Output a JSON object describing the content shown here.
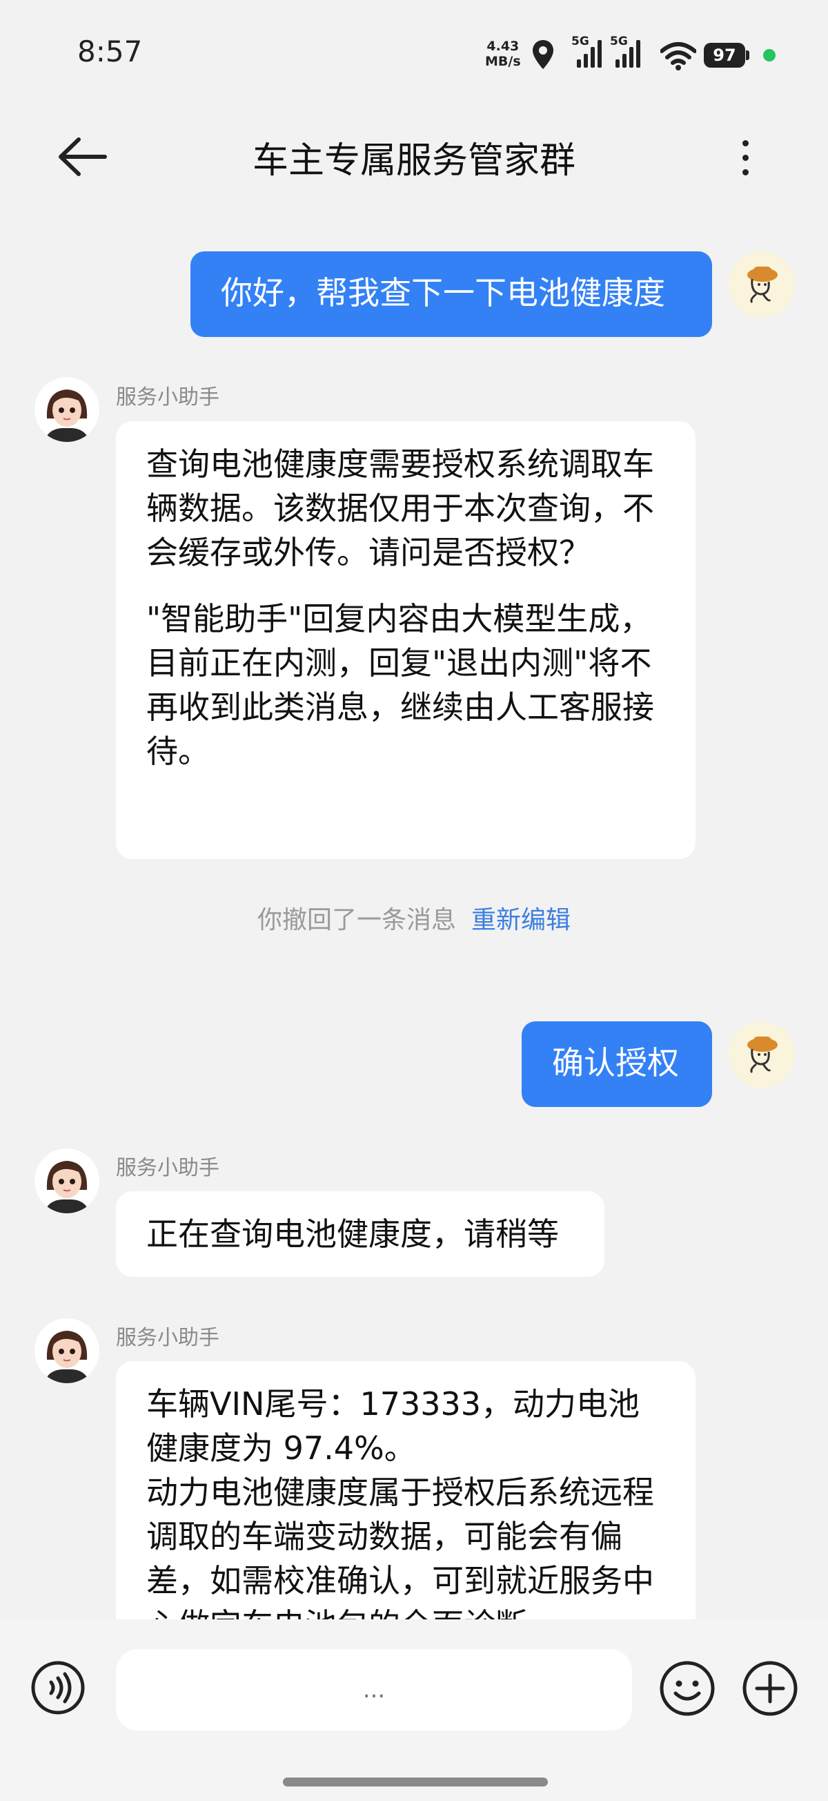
{
  "status_bar": {
    "time": "8:57",
    "net_speed_value": "4.43",
    "net_speed_unit": "MB/s",
    "signal_1_label": "5G",
    "signal_2_label": "5G",
    "battery": "97",
    "icons": [
      "location-icon",
      "signal-icon",
      "wifi-icon",
      "battery-icon"
    ]
  },
  "header": {
    "title": "车主专属服务管家群"
  },
  "messages": [
    {
      "from": "user",
      "text": "你好，帮我查下一下电池健康度"
    },
    {
      "from": "bot",
      "sender": "服务小助手",
      "paragraphs": [
        "查询电池健康度需要授权系统调取车辆数据。该数据仅用于本次查询，不会缓存或外传。请问是否授权？",
        "\"智能助手\"回复内容由大模型生成，目前正在内测，回复\"退出内测\"将不再收到此类消息，继续由人工客服接待。"
      ]
    },
    {
      "from": "system",
      "text": "你撤回了一条消息",
      "action": "重新编辑"
    },
    {
      "from": "user",
      "text": "确认授权"
    },
    {
      "from": "bot",
      "sender": "服务小助手",
      "text": "正在查询电池健康度，请稍等"
    },
    {
      "from": "bot",
      "sender": "服务小助手",
      "paragraphs": [
        "车辆VIN尾号：173333，动力电池健康度为 97.4%。",
        "动力电池健康度属于授权后系统远程调取的车端变动数据，可能会有偏差，如需校准确认，可到就近服务中心做完车电池包的全面诊断"
      ]
    }
  ],
  "input": {
    "placeholder": "..."
  },
  "colors": {
    "accent": "#3381f5",
    "link": "#3a7fe0",
    "background": "#f2f2f2"
  }
}
